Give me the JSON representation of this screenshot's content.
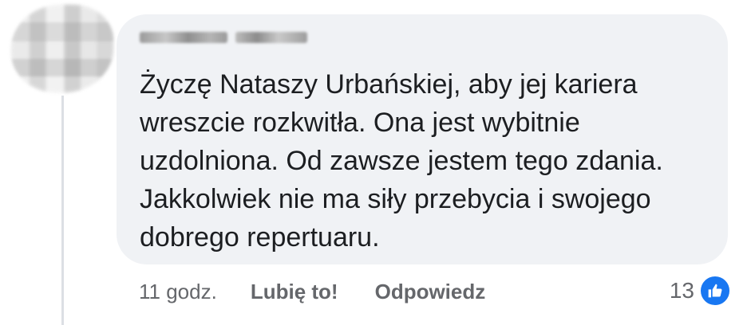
{
  "comment": {
    "text": "Życzę Nataszy Urbańskiej, aby jej kariera\nwreszcie rozkwitła. Ona jest wybitnie\nuzdolniona. Od zawsze jestem tego zdania.\nJakkolwiek nie ma siły przebycia i swojego\ndobrego repertuaru."
  },
  "actions": {
    "time": "11 godz.",
    "like_label": "Lubię to!",
    "reply_label": "Odpowiedz"
  },
  "reactions": {
    "count": "13",
    "icon": "like-thumb-icon",
    "color": "#1877f2"
  },
  "colors": {
    "bubble": "#f0f2f5",
    "text": "#1c1e21",
    "meta": "#65676b"
  }
}
